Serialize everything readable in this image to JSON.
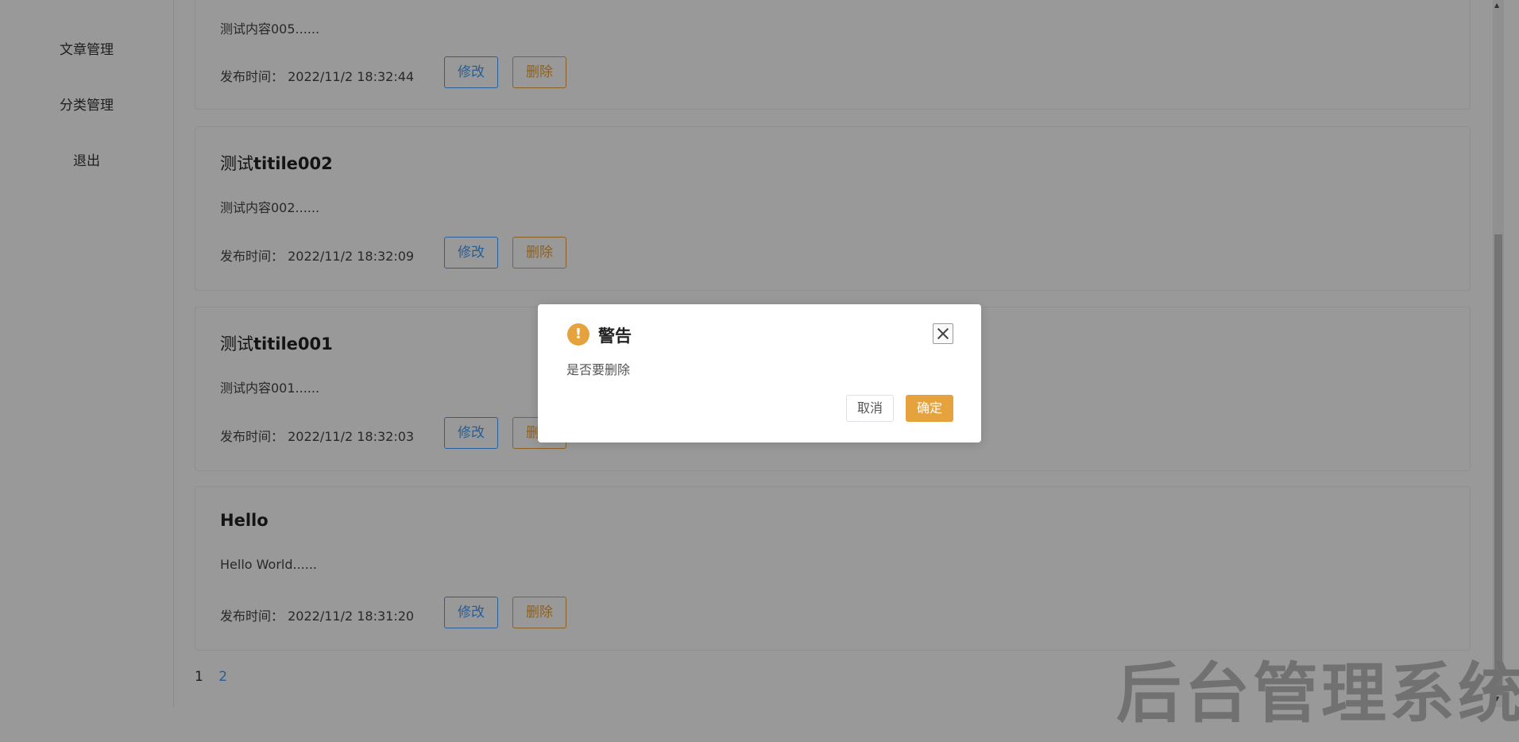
{
  "sidebar": {
    "items": [
      {
        "label": "文章管理"
      },
      {
        "label": "分类管理"
      },
      {
        "label": "退出"
      }
    ]
  },
  "articles": [
    {
      "title_prefix": "",
      "title_main": "",
      "content": "测试内容005......",
      "time_label": "发布时间：",
      "time": "2022/11/2 18:32:44",
      "edit_label": "修改",
      "delete_label": "删除"
    },
    {
      "title_prefix": "测试",
      "title_main": "titile002",
      "content": "测试内容002......",
      "time_label": "发布时间：",
      "time": "2022/11/2 18:32:09",
      "edit_label": "修改",
      "delete_label": "删除"
    },
    {
      "title_prefix": "测试",
      "title_main": "titile001",
      "content": "测试内容001......",
      "time_label": "发布时间：",
      "time": "2022/11/2 18:32:03",
      "edit_label": "修改",
      "delete_label": "删除"
    },
    {
      "title_prefix": "",
      "title_main": "Hello",
      "content": "Hello World......",
      "time_label": "发布时间：",
      "time": "2022/11/2 18:31:20",
      "edit_label": "修改",
      "delete_label": "删除"
    }
  ],
  "pagination": {
    "pages": [
      "1",
      "2"
    ],
    "current": "2"
  },
  "watermark": "后台管理系统",
  "dialog": {
    "icon": "warning-icon",
    "icon_glyph": "!",
    "title": "警告",
    "message": "是否要删除",
    "cancel_label": "取消",
    "confirm_label": "确定"
  },
  "colors": {
    "primary": "#409eff",
    "warning": "#e6a23c",
    "overlay": "rgba(0,0,0,0.4)"
  }
}
